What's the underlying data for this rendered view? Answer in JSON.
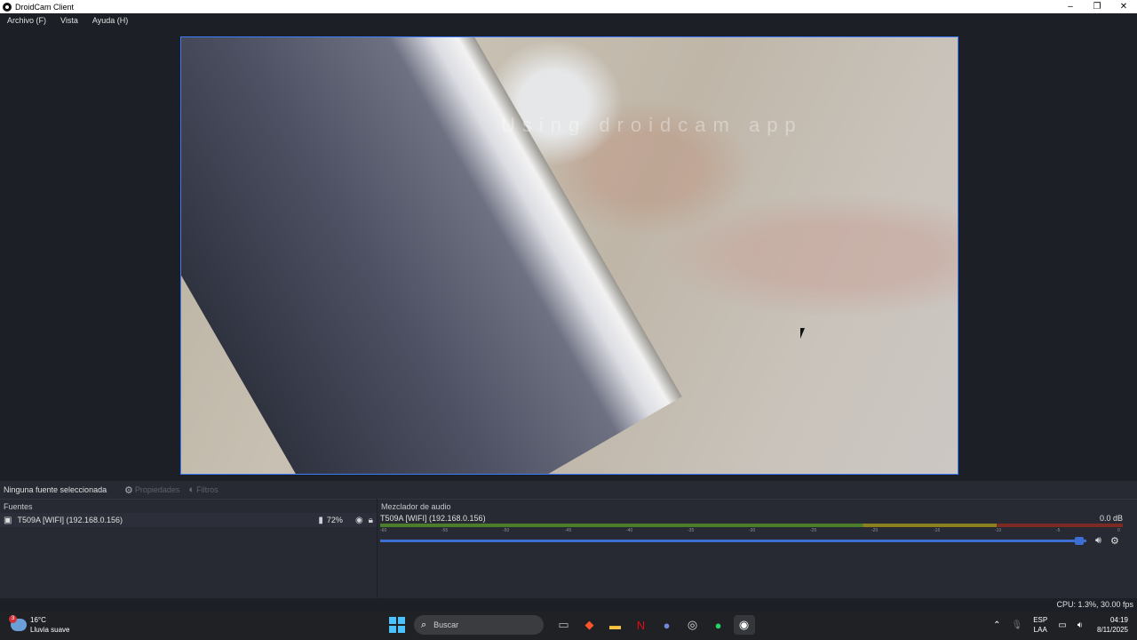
{
  "window": {
    "title": "DroidCam Client",
    "controls": [
      "–",
      "❐",
      "✕"
    ]
  },
  "menu": [
    "Archivo (F)",
    "Vista",
    "Ayuda (H)"
  ],
  "preview": {
    "watermark": "Using droidcam app"
  },
  "sources_toolbar": {
    "status": "Ninguna fuente seleccionada",
    "properties": "Propiedades",
    "filters": "Filtros"
  },
  "sources": {
    "title": "Fuentes",
    "items": [
      {
        "name": "T509A [WIFI] (192.168.0.156)",
        "battery": "72%"
      }
    ]
  },
  "mixer": {
    "title": "Mezclador de audio",
    "channel": "T509A [WIFI] (192.168.0.156)",
    "level": "0.0 dB",
    "volume_fraction": 0.99,
    "ticks": [
      "-60",
      "-55",
      "-50",
      "-45",
      "-40",
      "-35",
      "-30",
      "-25",
      "-20",
      "-15",
      "-10",
      "-5",
      "0"
    ]
  },
  "status": {
    "text": "CPU: 1.3%, 30.00 fps"
  },
  "taskbar": {
    "weather_temp": "16°C",
    "weather_desc": "Lluvia suave",
    "weather_badge": "3",
    "search_placeholder": "Buscar",
    "lang_1": "ESP",
    "lang_2": "LAA",
    "time": "04:19",
    "date": "8/11/2025"
  }
}
